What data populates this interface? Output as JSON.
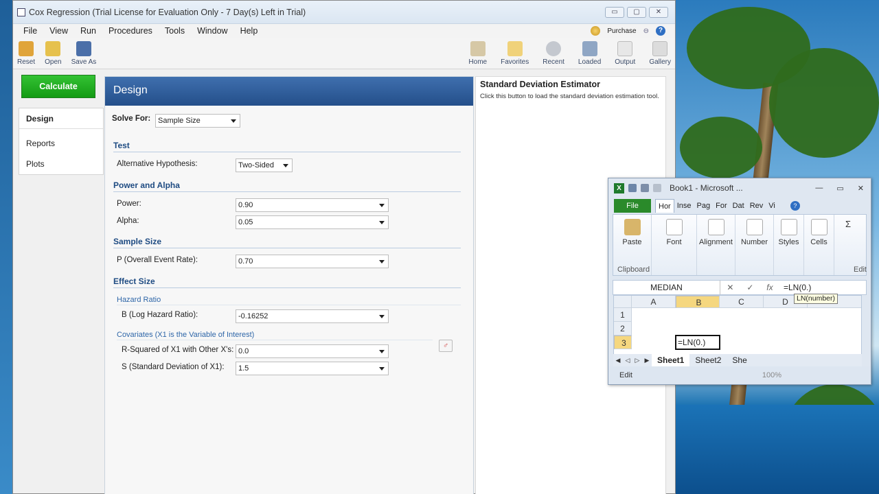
{
  "main_window": {
    "title": "Cox Regression (Trial License for Evaluation Only - 7 Day(s) Left in Trial)",
    "controls": [
      "▭",
      "▢",
      "✕"
    ]
  },
  "menu": {
    "items": [
      "File",
      "View",
      "Run",
      "Procedures",
      "Tools",
      "Window",
      "Help"
    ],
    "purchase": "Purchase"
  },
  "toolbar": {
    "left": [
      {
        "label": "Reset",
        "icon": "reset-icon",
        "color": "#e0a43a"
      },
      {
        "label": "Open",
        "icon": "open-folder-icon",
        "color": "#e6c14d"
      },
      {
        "label": "Save As",
        "icon": "save-icon",
        "color": "#4b6fa8"
      }
    ],
    "right": [
      {
        "label": "Home",
        "icon": "home-icon"
      },
      {
        "label": "Favorites",
        "icon": "star-icon"
      },
      {
        "label": "Recent",
        "icon": "clock-icon"
      },
      {
        "label": "Loaded",
        "icon": "loaded-icon"
      },
      {
        "label": "Output",
        "icon": "output-icon"
      },
      {
        "label": "Gallery",
        "icon": "gallery-icon"
      }
    ]
  },
  "left_panel": {
    "calculate": "Calculate",
    "nav": [
      "Design",
      "Reports",
      "Plots"
    ]
  },
  "design": {
    "header": "Design",
    "solve_for_label": "Solve For:",
    "solve_for_value": "Sample Size",
    "sections": {
      "test": "Test",
      "power_alpha": "Power and Alpha",
      "sample_size": "Sample Size",
      "effect_size": "Effect Size"
    },
    "fields": {
      "alt_hyp_label": "Alternative Hypothesis:",
      "alt_hyp_value": "Two-Sided",
      "power_label": "Power:",
      "power_value": "0.90",
      "alpha_label": "Alpha:",
      "alpha_value": "0.05",
      "p_label": "P (Overall Event Rate):",
      "p_value": "0.70",
      "hazard_sub": "Hazard Ratio",
      "b_label": "B (Log Hazard Ratio):",
      "b_value": "-0.16252",
      "cov_sub": "Covariates (X1 is the Variable of Interest)",
      "r2_label": "R-Squared of X1 with Other X's:",
      "r2_value": "0.0",
      "s_label": "S (Standard Deviation of X1):",
      "s_value": "1.5"
    }
  },
  "info_panel": {
    "title": "Standard Deviation Estimator",
    "text": "Click this button to load the standard deviation estimation tool."
  },
  "excel": {
    "title": "Book1 - Microsoft ...",
    "tabs": [
      "File",
      "Hor",
      "Inse",
      "Pag",
      "For",
      "Dat",
      "Rev",
      "Vi"
    ],
    "ribbon": {
      "paste": "Paste",
      "clipboard": "Clipboard",
      "font": "Font",
      "alignment": "Alignment",
      "number": "Number",
      "styles": "Styles",
      "cells": "Cells",
      "edit": "Edit"
    },
    "name_box": "MEDIAN",
    "formula": "=LN(0.)",
    "tooltip": "LN(number)",
    "columns": [
      "A",
      "B",
      "C",
      "D"
    ],
    "rows": [
      "1",
      "2",
      "3"
    ],
    "active_cell_value": "=LN(0.)",
    "sheets": [
      "Sheet1",
      "Sheet2",
      "She"
    ],
    "status": "Edit",
    "zoom": "100%"
  }
}
